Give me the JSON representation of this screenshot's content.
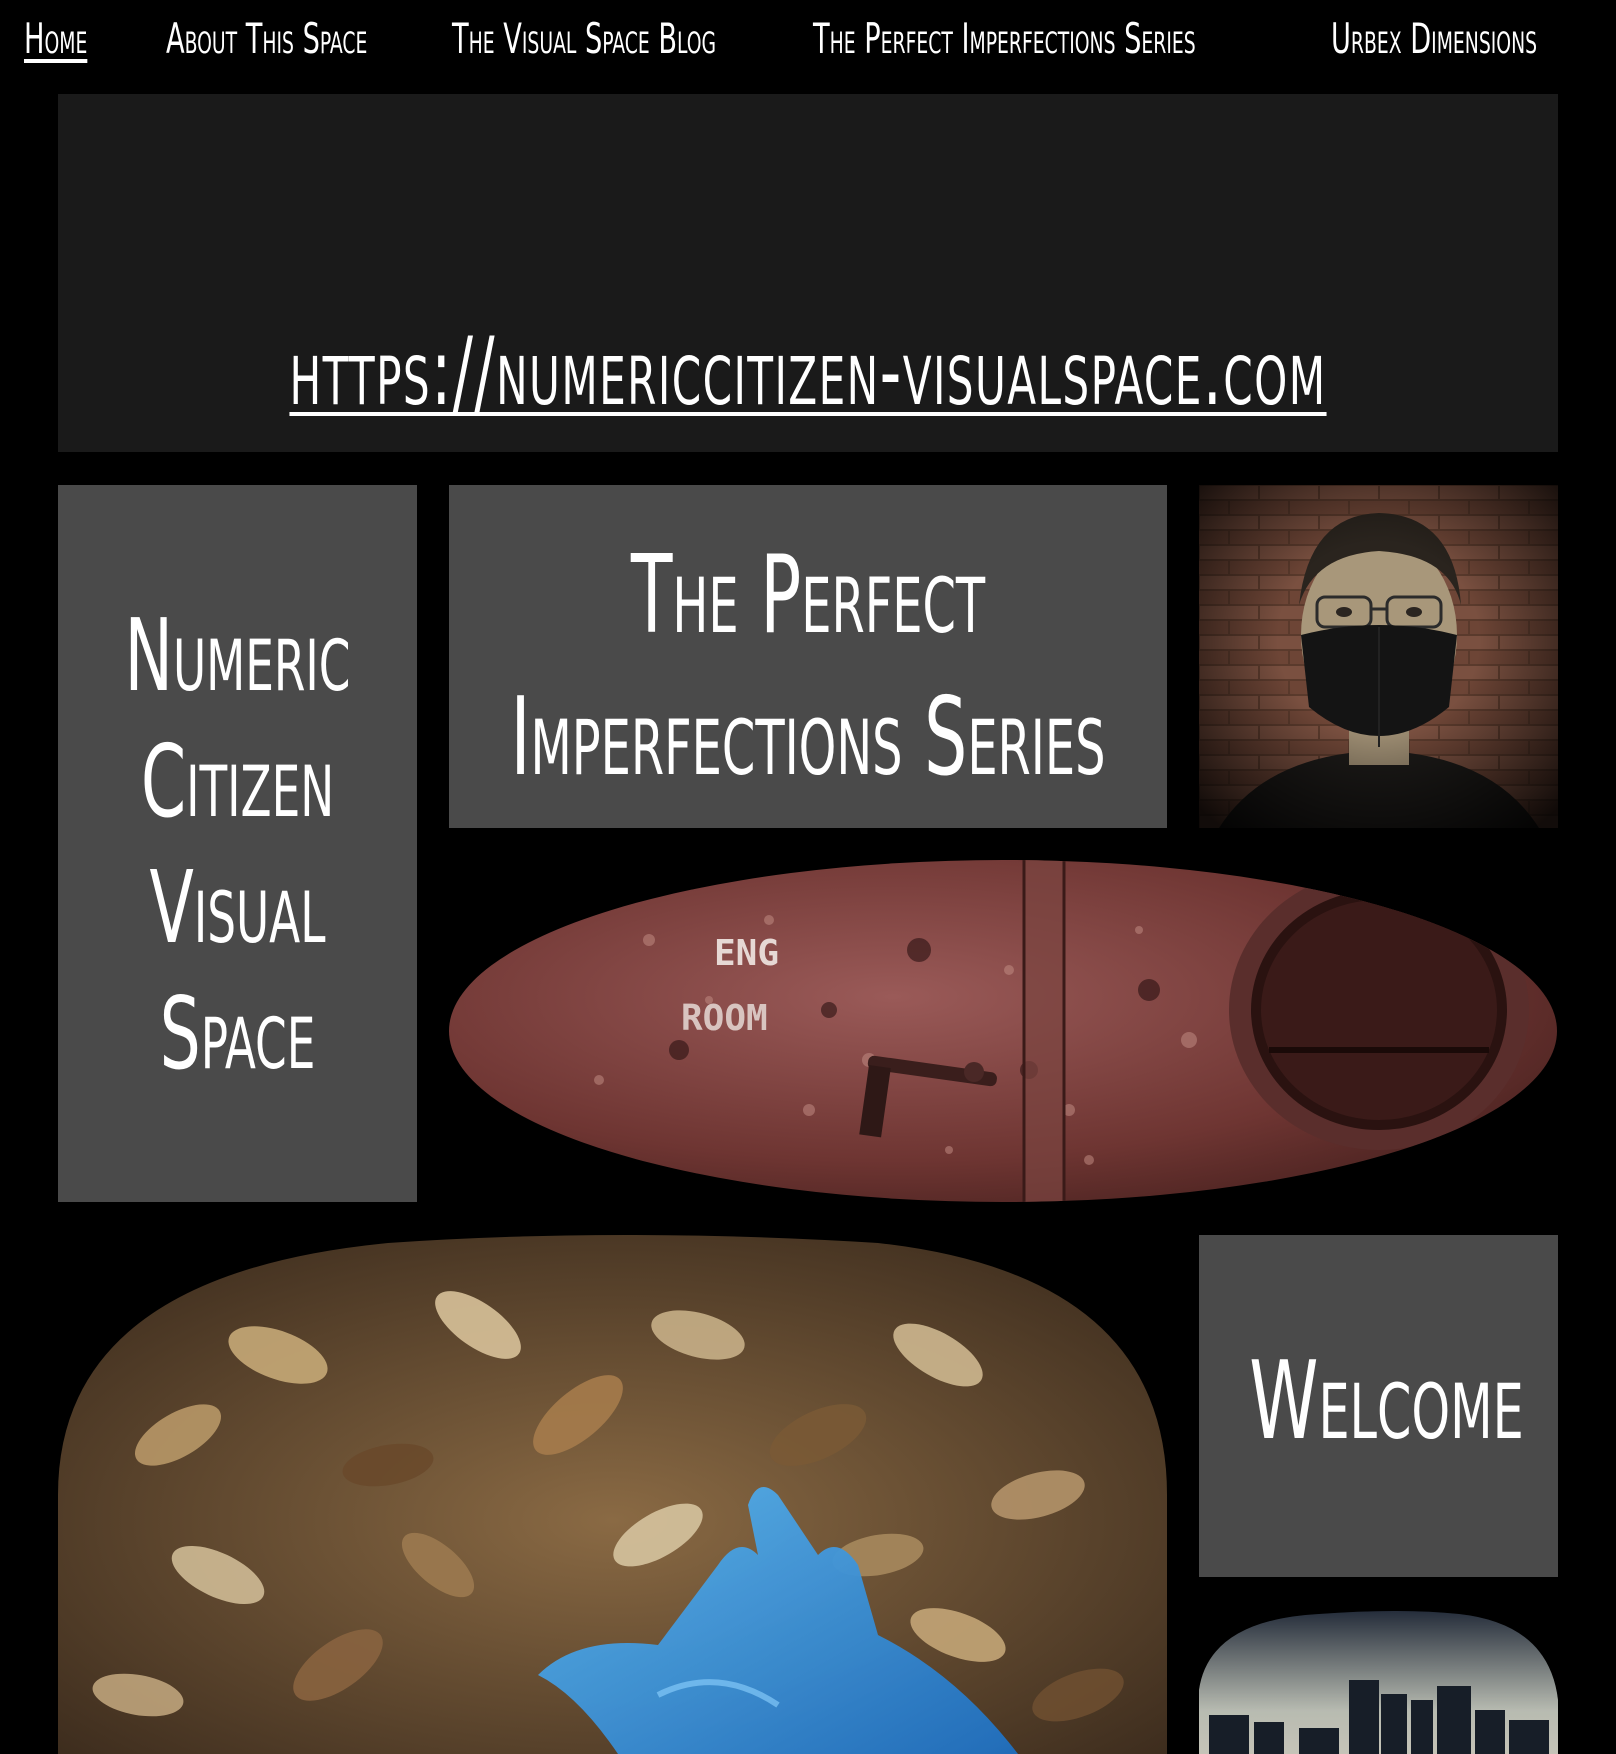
{
  "nav": {
    "items": [
      {
        "label": "Home",
        "active": true
      },
      {
        "label": "About This Space",
        "active": false
      },
      {
        "label": "The Visual Space Blog",
        "active": false
      },
      {
        "label": "The Perfect Imperfections Series",
        "active": false
      },
      {
        "label": "Urbex Dimensions",
        "active": false
      }
    ]
  },
  "hero": {
    "url": "https://numericcitizen-visualspace.com"
  },
  "tiles": {
    "site_title": [
      "Numeric",
      "Citizen",
      "Visual",
      "Space"
    ],
    "series_title": [
      "The Perfect",
      "Imperfections Series"
    ],
    "welcome": "Welcome"
  },
  "photos": {
    "portrait": {
      "icon": "portrait-masked-man"
    },
    "rusty_door": {
      "icon": "rusty-door-photo",
      "stencil": [
        "ENG",
        "ROOM"
      ]
    },
    "glove": {
      "icon": "blue-glove-leaves-photo"
    },
    "city": {
      "icon": "city-skyline-photo"
    }
  },
  "colors": {
    "page_bg": "#000000",
    "hero_bg": "#1a1a1a",
    "tile_bg": "#4a4a4a",
    "text": "#ffffff"
  }
}
